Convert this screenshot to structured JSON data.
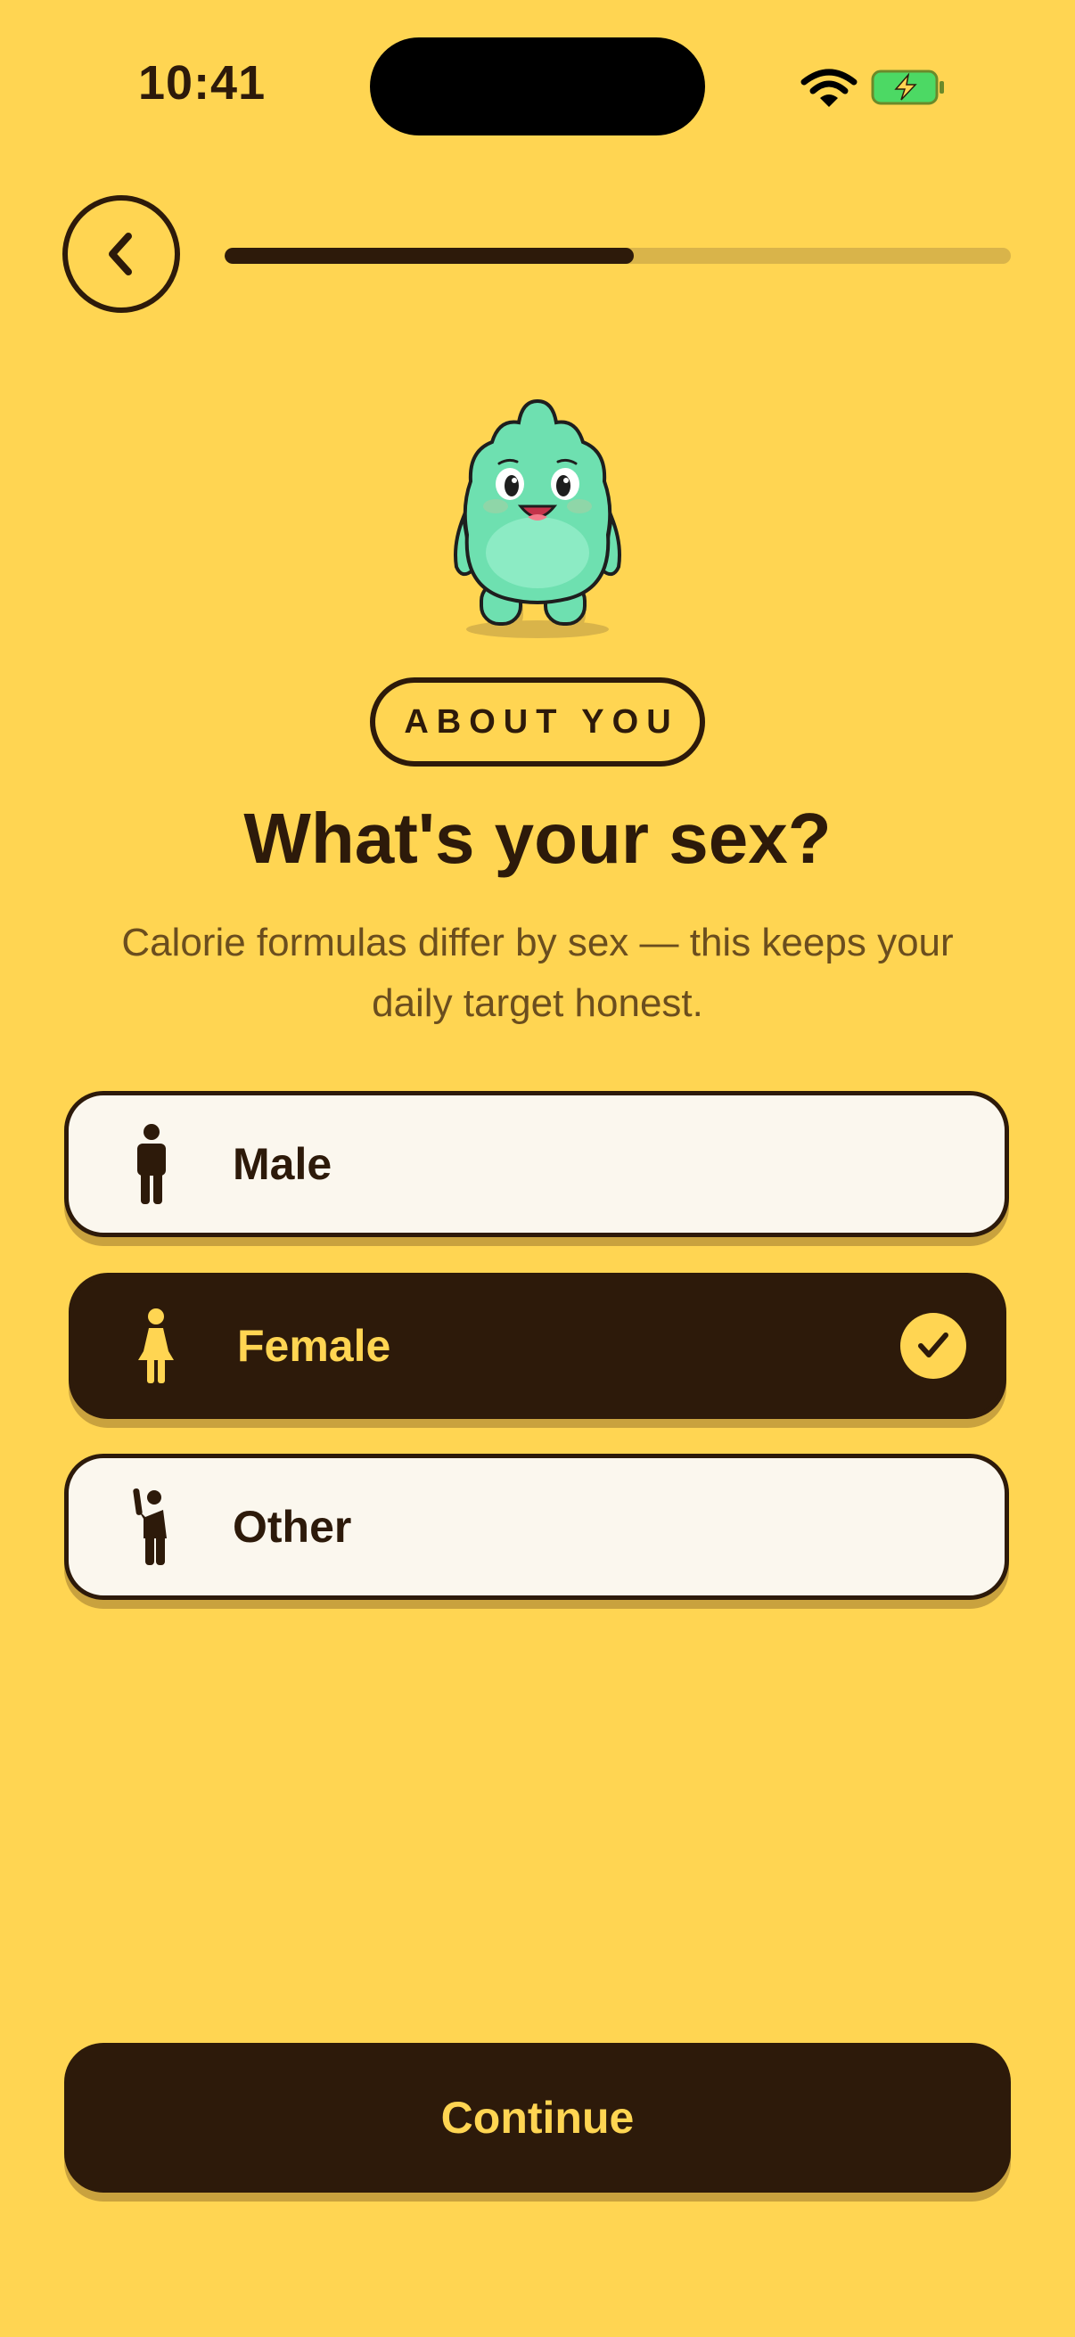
{
  "status_bar": {
    "time": "10:41",
    "wifi_icon": "wifi-icon",
    "battery_icon": "battery-charging-icon"
  },
  "header": {
    "back_icon": "chevron-left-icon",
    "progress_fraction": 0.52
  },
  "section_pill": "ABOUT YOU",
  "title": "What's your sex?",
  "subtitle": "Calorie formulas differ by sex — this keeps your daily target honest.",
  "options": [
    {
      "label": "Male",
      "icon": "male-figure-icon",
      "selected": false
    },
    {
      "label": "Female",
      "icon": "female-figure-icon",
      "selected": true
    },
    {
      "label": "Other",
      "icon": "waving-person-icon",
      "selected": false
    }
  ],
  "continue_label": "Continue",
  "colors": {
    "background": "#FFD552",
    "primary": "#2D1A0A",
    "card": "#FBF7EE",
    "mascot": "#6EE0B0"
  }
}
